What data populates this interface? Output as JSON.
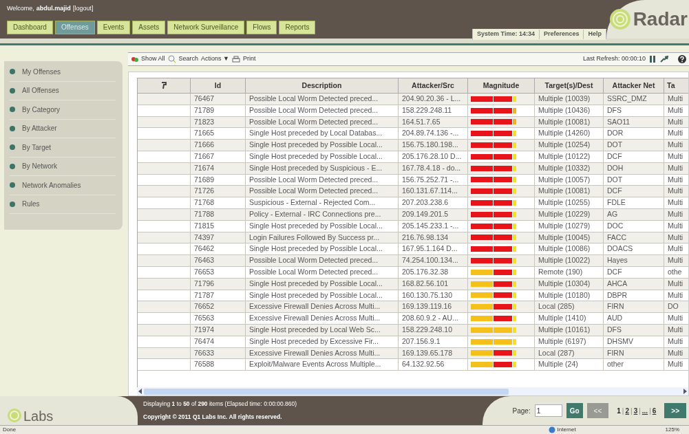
{
  "header": {
    "welcome": "Welcome,",
    "user": "abdul.majid",
    "logout": "[logout]",
    "logo": "Radar",
    "system_time_label": "System Time:",
    "system_time": "14:34",
    "links": [
      "Preferences",
      "Help"
    ]
  },
  "tabs": [
    {
      "label": "Dashboard",
      "selected": false
    },
    {
      "label": "Offenses",
      "selected": true
    },
    {
      "label": "Events",
      "selected": false
    },
    {
      "label": "Assets",
      "selected": false
    },
    {
      "label": "Network Surveillance",
      "selected": false
    },
    {
      "label": "Flows",
      "selected": false
    },
    {
      "label": "Reports",
      "selected": false
    }
  ],
  "sidebar": {
    "items": [
      {
        "label": "My Offenses"
      },
      {
        "label": "All Offenses"
      },
      {
        "label": "By Category"
      },
      {
        "label": "By Attacker"
      },
      {
        "label": "By Target"
      },
      {
        "label": "By Network"
      },
      {
        "label": "Network Anomalies"
      },
      {
        "label": "Rules"
      }
    ]
  },
  "toolbar": {
    "show_all": "Show All",
    "search": "Search",
    "actions": "Actions ▼",
    "print": "Print",
    "last_refresh": "Last Refresh: 00:00:10"
  },
  "table": {
    "columns": [
      "Id",
      "Description",
      "Attacker/Src",
      "Magnitude",
      "Target(s)/Dest",
      "Attacker Net",
      "Ta"
    ],
    "rows": [
      {
        "id": "76467",
        "description": "Possible Local Worm Detected preced...",
        "attacker": "204.90.20.36 - L...",
        "magnitude": [
          {
            "color": "#e8141a"
          },
          {
            "color": "#e8141a"
          },
          {
            "color": "#f5e11c"
          }
        ],
        "target": "Multiple (10039)",
        "attacker_net": "SSRC_DMZ",
        "column_7": "Multi"
      },
      {
        "id": "71789",
        "description": "Possible Local Worm Detected preced...",
        "attacker": "158.229.248.11",
        "magnitude": [
          {
            "color": "#e8141a"
          },
          {
            "color": "#e8141a"
          },
          {
            "color": "#f0b41a"
          }
        ],
        "target": "Multiple (10436)",
        "attacker_net": "DFS",
        "column_7": "Multi"
      },
      {
        "id": "71823",
        "description": "Possible Local Worm Detected preced...",
        "attacker": "164.51.7.65",
        "magnitude": [
          {
            "color": "#e8141a"
          },
          {
            "color": "#e8141a"
          },
          {
            "color": "#f0b41a"
          }
        ],
        "target": "Multiple (10081)",
        "attacker_net": "SAO11",
        "column_7": "Multi"
      },
      {
        "id": "71665",
        "description": "Single Host preceded by Local Databas...",
        "attacker": "204.89.74.136 -...",
        "magnitude": [
          {
            "color": "#e8141a"
          },
          {
            "color": "#e8141a"
          },
          {
            "color": "#f5e11c"
          }
        ],
        "target": "Multiple (14260)",
        "attacker_net": "DOR",
        "column_7": "Multi"
      },
      {
        "id": "71666",
        "description": "Single Host preceded by Possible Local...",
        "attacker": "156.75.180.198...",
        "magnitude": [
          {
            "color": "#e8141a"
          },
          {
            "color": "#e8141a"
          },
          {
            "color": "#f5e11c"
          }
        ],
        "target": "Multiple (10254)",
        "attacker_net": "DOT",
        "column_7": "Multi"
      },
      {
        "id": "71667",
        "description": "Single Host preceded by Possible Local...",
        "attacker": "205.176.28.10 D...",
        "magnitude": [
          {
            "color": "#e8141a"
          },
          {
            "color": "#e8141a"
          },
          {
            "color": "#f5e11c"
          }
        ],
        "target": "Multiple (10122)",
        "attacker_net": "DCF",
        "column_7": "Multi"
      },
      {
        "id": "71674",
        "description": "Single Host preceded by Suspicious - E...",
        "attacker": "167.78.4.18 - do...",
        "magnitude": [
          {
            "color": "#e8141a"
          },
          {
            "color": "#e8141a"
          },
          {
            "color": "#f5e11c"
          }
        ],
        "target": "Multiple (10332)",
        "attacker_net": "DOH",
        "column_7": "Multi"
      },
      {
        "id": "71689",
        "description": "Possible Local Worm Detected preced...",
        "attacker": "156.75.252.71 -...",
        "magnitude": [
          {
            "color": "#e8141a"
          },
          {
            "color": "#e8141a"
          },
          {
            "color": "#f5e11c"
          }
        ],
        "target": "Multiple (10057)",
        "attacker_net": "DOT",
        "column_7": "Multi"
      },
      {
        "id": "71726",
        "description": "Possible Local Worm Detected preced...",
        "attacker": "160.131.67.114...",
        "magnitude": [
          {
            "color": "#e8141a"
          },
          {
            "color": "#e8141a"
          },
          {
            "color": "#f5e11c"
          }
        ],
        "target": "Multiple (10081)",
        "attacker_net": "DCF",
        "column_7": "Multi"
      },
      {
        "id": "71768",
        "description": "Suspicious - External - Rejected Com...",
        "attacker": "207.203.238.6",
        "magnitude": [
          {
            "color": "#e8141a"
          },
          {
            "color": "#e8141a"
          },
          {
            "color": "#f5e11c"
          }
        ],
        "target": "Multiple (10255)",
        "attacker_net": "FDLE",
        "column_7": "Multi"
      },
      {
        "id": "71788",
        "description": "Policy - External - IRC Connections pre...",
        "attacker": "209.149.201.5",
        "magnitude": [
          {
            "color": "#e8141a"
          },
          {
            "color": "#e8141a"
          },
          {
            "color": "#f5e11c"
          }
        ],
        "target": "Multiple (10229)",
        "attacker_net": "AG",
        "column_7": "Multi"
      },
      {
        "id": "71815",
        "description": "Single Host preceded by Possible Local...",
        "attacker": "205.145.233.1 -...",
        "magnitude": [
          {
            "color": "#e8141a"
          },
          {
            "color": "#e8141a"
          },
          {
            "color": "#f5e11c"
          }
        ],
        "target": "Multiple (10279)",
        "attacker_net": "DOC",
        "column_7": "Multi"
      },
      {
        "id": "74397",
        "description": "Login Failures Followed By Success pr...",
        "attacker": "216.76.98.134",
        "magnitude": [
          {
            "color": "#e8141a"
          },
          {
            "color": "#e8141a"
          },
          {
            "color": "#f5e11c"
          }
        ],
        "target": "Multiple (10045)",
        "attacker_net": "FACC",
        "column_7": "Multi"
      },
      {
        "id": "76462",
        "description": "Single Host preceded by Possible Local...",
        "attacker": "167.95.1.164 D...",
        "magnitude": [
          {
            "color": "#e8141a"
          },
          {
            "color": "#e8141a"
          },
          {
            "color": "#f5e11c"
          }
        ],
        "target": "Multiple (10086)",
        "attacker_net": "DOACS",
        "column_7": "Multi"
      },
      {
        "id": "76463",
        "description": "Possible Local Worm Detected preced...",
        "attacker": "74.254.100.134...",
        "magnitude": [
          {
            "color": "#e8141a"
          },
          {
            "color": "#e8141a"
          },
          {
            "color": "#f5e11c"
          }
        ],
        "target": "Multiple (10022)",
        "attacker_net": "Hayes",
        "column_7": "Multi"
      },
      {
        "id": "76653",
        "description": "Possible Local Worm Detected preced...",
        "attacker": "205.176.32.38",
        "magnitude": [
          {
            "color": "#f5c01a"
          },
          {
            "color": "#e8141a"
          },
          {
            "color": "#f5e11c"
          }
        ],
        "target": "Remote (190)",
        "attacker_net": "DCF",
        "column_7": "othe"
      },
      {
        "id": "71796",
        "description": "Single Host preceded by Possible Local...",
        "attacker": "168.82.56.101",
        "magnitude": [
          {
            "color": "#f5c01a"
          },
          {
            "color": "#e8141a"
          },
          {
            "color": "#f5e11c"
          }
        ],
        "target": "Multiple (10304)",
        "attacker_net": "AHCA",
        "column_7": "Multi"
      },
      {
        "id": "71787",
        "description": "Single Host preceded by Possible Local...",
        "attacker": "160.130.75.130",
        "magnitude": [
          {
            "color": "#f5c01a"
          },
          {
            "color": "#e8141a"
          },
          {
            "color": "#f5e11c"
          }
        ],
        "target": "Multiple (10180)",
        "attacker_net": "DBPR",
        "column_7": "Multi"
      },
      {
        "id": "76652",
        "description": "Excessive Firewall Denies Across Multi...",
        "attacker": "169.139.119.16",
        "magnitude": [
          {
            "color": "#f5c01a"
          },
          {
            "color": "#e8141a"
          },
          {
            "color": "#f5e11c"
          }
        ],
        "target": "Local (285)",
        "attacker_net": "FIRN",
        "column_7": "DO"
      },
      {
        "id": "76563",
        "description": "Excessive Firewall Denies Across Multi...",
        "attacker": "208.60.9.2 - AU...",
        "magnitude": [
          {
            "color": "#f5c01a"
          },
          {
            "color": "#e8141a"
          },
          {
            "color": "#f5e11c"
          }
        ],
        "target": "Multiple (1410)",
        "attacker_net": "AUD",
        "column_7": "Multi"
      },
      {
        "id": "71974",
        "description": "Single Host preceded by Local Web Sc...",
        "attacker": "158.229.248.10",
        "magnitude": [
          {
            "color": "#f5c01a"
          },
          {
            "color": "#f5c01a"
          },
          {
            "color": "#f5e11c"
          }
        ],
        "target": "Multiple (10161)",
        "attacker_net": "DFS",
        "column_7": "Multi"
      },
      {
        "id": "76474",
        "description": "Single Host preceded by Excessive Fir...",
        "attacker": "207.156.9.1",
        "magnitude": [
          {
            "color": "#f5c01a"
          },
          {
            "color": "#f5c01a"
          },
          {
            "color": "#f5e11c"
          }
        ],
        "target": "Multiple (6197)",
        "attacker_net": "DHSMV",
        "column_7": "Multi"
      },
      {
        "id": "76633",
        "description": "Excessive Firewall Denies Across Multi...",
        "attacker": "169.139.65.178",
        "magnitude": [
          {
            "color": "#f5c01a"
          },
          {
            "color": "#e8141a"
          },
          {
            "color": "#f5e11c"
          }
        ],
        "target": "Local (287)",
        "attacker_net": "FIRN",
        "column_7": "Multi"
      },
      {
        "id": "76588",
        "description": "Exploit/Malware Events Across Multiple...",
        "attacker": "64.132.92.56",
        "magnitude": [
          {
            "color": "#f5c01a"
          },
          {
            "color": "#e8141a"
          },
          {
            "color": "#f5e11c"
          }
        ],
        "target": "Multiple (24)",
        "attacker_net": "other",
        "column_7": "Multi"
      }
    ]
  },
  "footer": {
    "displaying": "Displaying **1** to **50** of **290** items (Elapsed time: 0:00:00.860)",
    "copyright": "Copyright © 2011 Q1 Labs Inc. All rights reserved.",
    "logo": "Labs",
    "page_label": "Page:",
    "page_value": "1",
    "go": "Go",
    "prev": "<<",
    "pages": [
      {
        "label": "1",
        "selected": true
      },
      {
        "label": "2",
        "selected": false
      },
      {
        "label": "3",
        "selected": false
      },
      {
        "label": "...",
        "selected": false
      },
      {
        "label": "6",
        "selected": false
      }
    ],
    "separator": "|",
    "next": ">>"
  },
  "status_bar": {
    "left": "Done",
    "zone": "Internet",
    "zoom": "125%"
  }
}
